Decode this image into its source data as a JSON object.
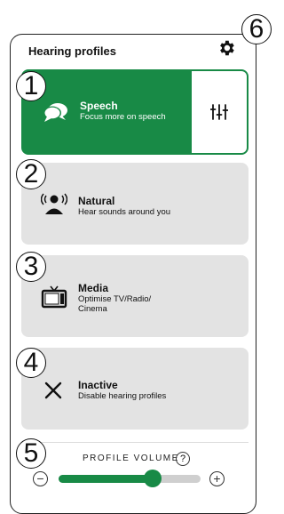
{
  "header": {
    "title": "Hearing profiles",
    "settings_icon": "gear-icon"
  },
  "profiles": [
    {
      "title": "Speech",
      "subtitle": "Focus more on speech",
      "icon": "speech-bubbles-icon",
      "selected": true,
      "action_icon": "equalizer-icon"
    },
    {
      "title": "Natural",
      "subtitle": "Hear sounds around you",
      "icon": "person-sound-icon",
      "selected": false
    },
    {
      "title": "Media",
      "subtitle": "Optimise TV/Radio/\nCinema",
      "subtitle_line1": "Optimise TV/Radio/",
      "subtitle_line2": "Cinema",
      "icon": "tv-icon",
      "selected": false
    },
    {
      "title": "Inactive",
      "subtitle": "Disable hearing profiles",
      "icon": "close-icon",
      "selected": false
    }
  ],
  "volume": {
    "label": "PROFILE VOLUME",
    "help": "?",
    "decrease": "−",
    "increase": "+",
    "level": 0.66
  },
  "callouts": [
    "1",
    "2",
    "3",
    "4",
    "5",
    "6"
  ],
  "colors": {
    "accent": "#188a46",
    "card_bg": "#e3e3e3"
  }
}
